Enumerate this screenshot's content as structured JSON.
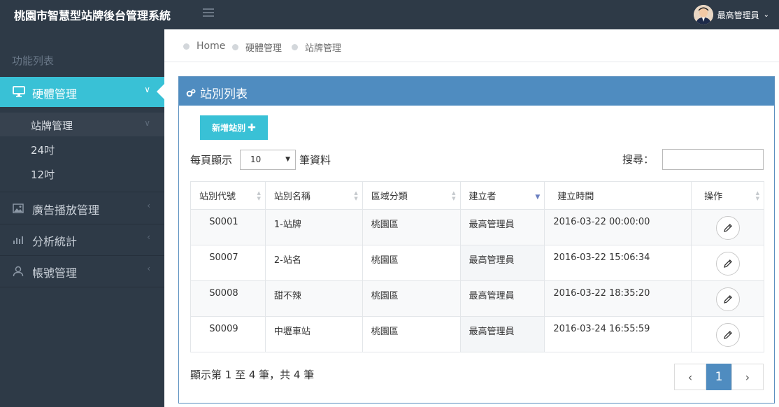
{
  "header": {
    "title": "桃園市智慧型站牌後台管理系統",
    "user_name": "最高管理員"
  },
  "sidebar": {
    "section_title": "功能列表",
    "active_item": "硬體管理",
    "sub_items": [
      "站牌管理",
      "24吋",
      "12吋"
    ],
    "items": [
      "廣告播放管理",
      "分析統計",
      "帳號管理"
    ]
  },
  "breadcrumb": [
    "Home",
    "硬體管理",
    "站牌管理"
  ],
  "panel": {
    "title": "站別列表",
    "add_button": "新增站別",
    "per_page_prefix": "每頁顯示",
    "per_page_value": "10",
    "per_page_suffix": "筆資料",
    "search_label": "搜尋："
  },
  "table": {
    "headers": [
      "站別代號",
      "站別名稱",
      "區域分類",
      "建立者",
      "建立時間",
      "操作"
    ],
    "rows": [
      [
        "S0001",
        "1-站牌",
        "桃園區",
        "最高管理員",
        "2016-03-22 00:00:00"
      ],
      [
        "S0007",
        "2-站名",
        "桃園區",
        "最高管理員",
        "2016-03-22 15:06:34"
      ],
      [
        "S0008",
        "甜不辣",
        "桃園區",
        "最高管理員",
        "2016-03-22 18:35:20"
      ],
      [
        "S0009",
        "中壢車站",
        "桃園區",
        "最高管理員",
        "2016-03-24 16:55:59"
      ]
    ]
  },
  "footer": {
    "info": "顯示第 1 至 4 筆，共 4 筆",
    "current_page": "1",
    "prev": "‹",
    "next": "›"
  },
  "colors": {
    "topbar": "#2e3a47",
    "accent": "#39c1d6",
    "panel_header": "#4f8cc0"
  }
}
